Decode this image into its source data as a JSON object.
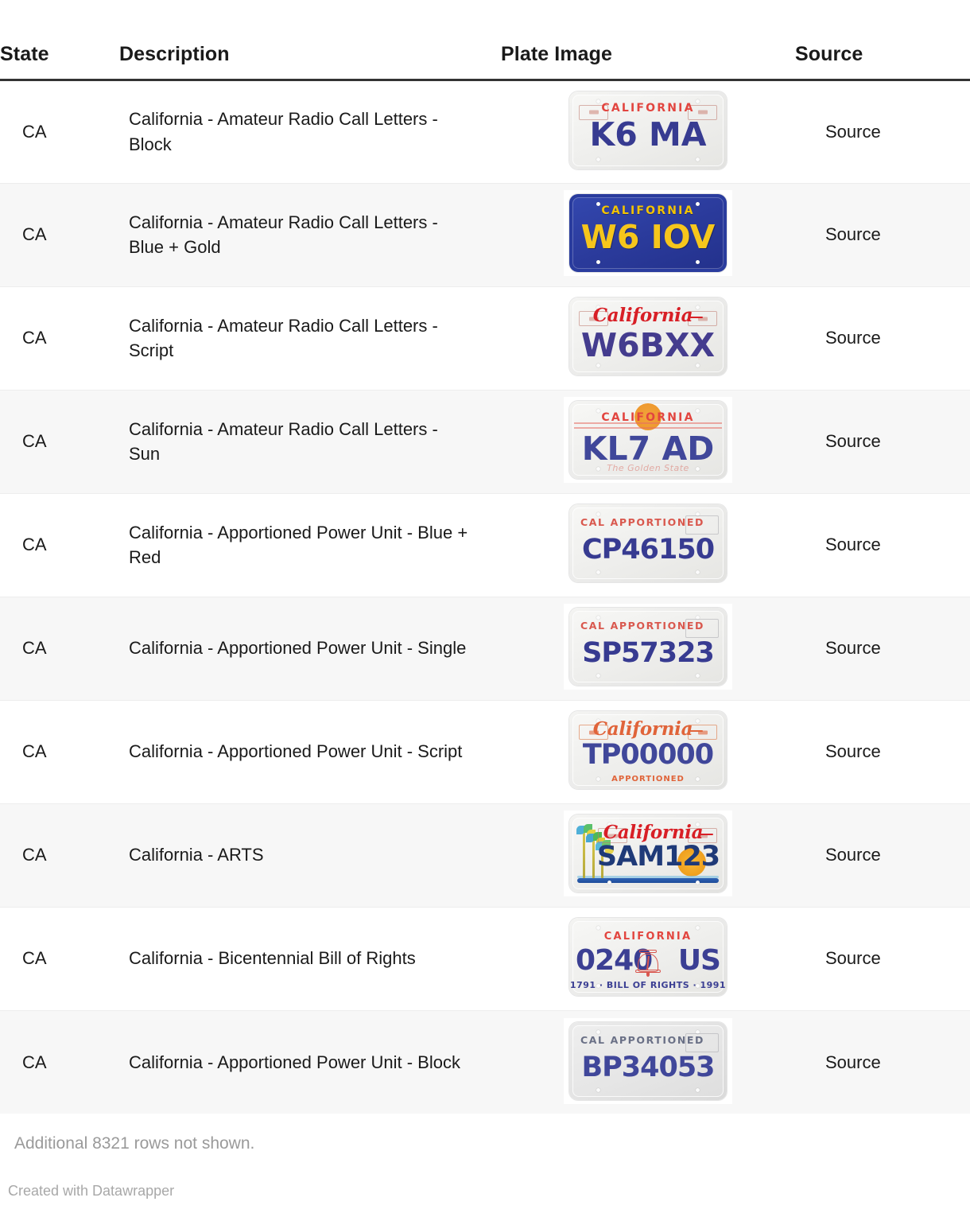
{
  "table": {
    "columns": [
      {
        "key": "state",
        "label": "State"
      },
      {
        "key": "desc",
        "label": "Description"
      },
      {
        "key": "plate",
        "label": "Plate Image"
      },
      {
        "key": "source",
        "label": "Source"
      }
    ],
    "rows": [
      {
        "state": "CA",
        "desc": "California - Amateur Radio Call Letters - Block",
        "source": "Source",
        "plate": {
          "design": "white-block",
          "wordmark": "CALIFORNIA",
          "wordmark_style": "block-red",
          "serial": "K6 MA",
          "serial_color": "#373b91",
          "bottom_text": "",
          "background": "#f0f0ee"
        }
      },
      {
        "state": "CA",
        "desc": "California - Amateur Radio Call Letters - Blue + Gold",
        "source": "Source",
        "plate": {
          "design": "blue-gold",
          "wordmark": "CALIFORNIA",
          "wordmark_style": "block-gold",
          "serial": "W6 IOV",
          "serial_color": "#f6c61c",
          "bottom_text": "",
          "background": "#2b3b9c"
        }
      },
      {
        "state": "CA",
        "desc": "California - Amateur Radio Call Letters - Script",
        "source": "Source",
        "plate": {
          "design": "white-script",
          "wordmark": "California",
          "wordmark_style": "script-red",
          "serial": "W6BXX",
          "serial_color": "#443c8e",
          "bottom_text": "",
          "background": "#f0f0ee"
        }
      },
      {
        "state": "CA",
        "desc": "California - Amateur Radio Call Letters - Sun",
        "source": "Source",
        "plate": {
          "design": "white-sun",
          "wordmark": "CALIFORNIA",
          "wordmark_style": "block-red",
          "serial": "KL7 AD",
          "serial_color": "#3a53b4",
          "bottom_text": "The Golden State",
          "background": "#f1f1ef"
        }
      },
      {
        "state": "CA",
        "desc": "California - Apportioned Power Unit - Blue + Red",
        "source": "Source",
        "plate": {
          "design": "white-apportioned-red",
          "wordmark": "CAL APPORTIONED",
          "wordmark_style": "block-red-small",
          "serial": "CP46150",
          "serial_color": "#373b91",
          "bottom_text": "",
          "background": "#f0f0ee"
        }
      },
      {
        "state": "CA",
        "desc": "California - Apportioned Power Unit - Single",
        "source": "Source",
        "plate": {
          "design": "white-apportioned-red",
          "wordmark": "CAL APPORTIONED",
          "wordmark_style": "block-red-small",
          "serial": "SP57323",
          "serial_color": "#373b91",
          "bottom_text": "",
          "background": "#f0f0ee"
        }
      },
      {
        "state": "CA",
        "desc": "California - Apportioned Power Unit - Script",
        "source": "Source",
        "plate": {
          "design": "white-script-apportioned",
          "wordmark": "California",
          "wordmark_style": "script-orange",
          "serial": "TP00000",
          "serial_color": "#40479a",
          "bottom_text": "APPORTIONED",
          "background": "#f2f1ee"
        }
      },
      {
        "state": "CA",
        "desc": "California - ARTS",
        "source": "Source",
        "plate": {
          "design": "arts",
          "wordmark": "California",
          "wordmark_style": "script-red",
          "serial": "SAM123",
          "serial_color": "#1f3a78",
          "bottom_text": "",
          "background": "#eef2f3"
        }
      },
      {
        "state": "CA",
        "desc": "California - Bicentennial Bill of Rights",
        "source": "Source",
        "plate": {
          "design": "bill-of-rights",
          "wordmark": "CALIFORNIA",
          "wordmark_style": "block-red",
          "serial_left": "0240",
          "serial_right": "US",
          "serial": "0240 US",
          "serial_color": "#3b3f93",
          "bottom_text": "1791 · BILL OF RIGHTS · 1991",
          "background": "#efefec"
        }
      },
      {
        "state": "CA",
        "desc": "California - Apportioned Power Unit - Block",
        "source": "Source",
        "plate": {
          "design": "white-apportioned-slate",
          "wordmark": "CAL APPORTIONED",
          "wordmark_style": "block-slate",
          "serial": "BP34053",
          "serial_color": "#40479a",
          "bottom_text": "",
          "background": "#e9e9e9"
        }
      }
    ]
  },
  "footnote": "Additional 8321 rows not shown.",
  "credit": "Created with Datawrapper",
  "colors": {
    "header_rule": "#333333",
    "row_alt_bg": "#f7f7f7",
    "row_bg": "#ffffff",
    "text": "#1a1a1a",
    "muted_text": "#9a9a9a"
  }
}
